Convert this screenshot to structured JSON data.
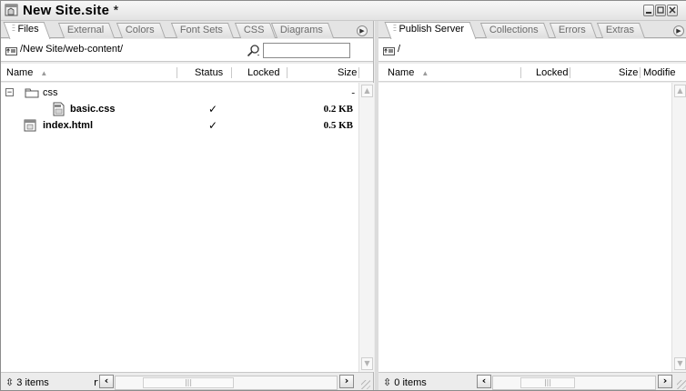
{
  "window": {
    "title": "New Site.site",
    "modified_marker": "*"
  },
  "left_pane": {
    "tabs": [
      "Files",
      "External",
      "Colors",
      "Font Sets",
      "CSS",
      "Diagrams"
    ],
    "path": "/New Site/web-content/",
    "search_value": "",
    "columns": {
      "name": "Name",
      "status": "Status",
      "locked": "Locked",
      "size": "Size"
    },
    "rows": [
      {
        "name": "css",
        "type": "folder",
        "status": "",
        "size": "-"
      },
      {
        "name": "basic.css",
        "type": "css-file",
        "status": "✓",
        "size": "0.2 KB"
      },
      {
        "name": "index.html",
        "type": "html-file",
        "status": "✓",
        "size": "0.5 KB"
      }
    ],
    "status_text": "3 items",
    "scroll_prefix": "r"
  },
  "right_pane": {
    "tabs": [
      "Publish Server",
      "Collections",
      "Errors",
      "Extras"
    ],
    "path": "/",
    "columns": {
      "name": "Name",
      "locked": "Locked",
      "size": "Size",
      "modified": "Modifie"
    },
    "status_text": "0 items"
  }
}
